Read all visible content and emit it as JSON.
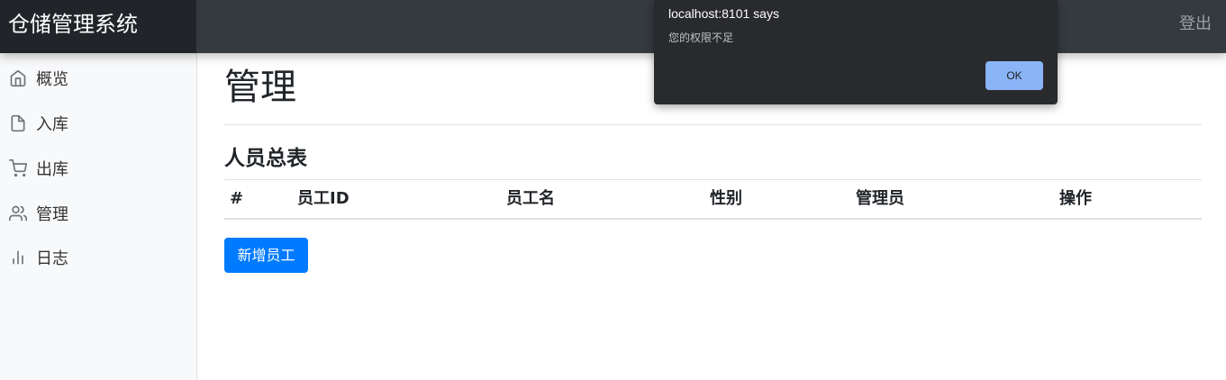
{
  "navbar": {
    "brand": "仓储管理系统",
    "logout_label": "登出"
  },
  "sidebar": {
    "items": [
      {
        "label": "概览",
        "icon": "home-icon"
      },
      {
        "label": "入库",
        "icon": "file-icon"
      },
      {
        "label": "出库",
        "icon": "shopping-cart-icon"
      },
      {
        "label": "管理",
        "icon": "users-icon"
      },
      {
        "label": "日志",
        "icon": "bar-chart-icon"
      }
    ]
  },
  "main": {
    "title": "管理",
    "section_title": "人员总表",
    "table": {
      "columns": [
        "#",
        "员工ID",
        "员工名",
        "性别",
        "管理员",
        "操作"
      ],
      "rows": []
    },
    "add_button_label": "新增员工"
  },
  "dialog": {
    "title": "localhost:8101 says",
    "message": "您的权限不足",
    "ok_label": "OK"
  },
  "colors": {
    "navbar_bg": "#343a40",
    "brand_bg": "#212529",
    "primary": "#007bff",
    "dialog_bg": "#292a2d",
    "dialog_button": "#8ab4f8"
  }
}
